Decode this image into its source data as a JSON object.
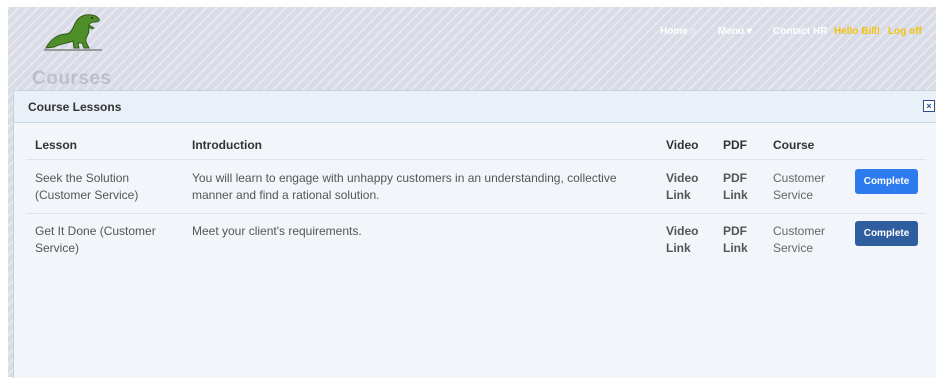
{
  "page": {
    "heading": "Courses"
  },
  "nav": {
    "home": "Home",
    "menu": "Menu",
    "contact": "Contact HR",
    "greeting": "Hello Bill!",
    "logoff": "Log off"
  },
  "icons": {
    "home": "home-icon",
    "menu": "caret-down-icon",
    "close": "close-icon",
    "logo": "dinosaur-logo"
  },
  "colors": {
    "primary_button": "#2e7bf0",
    "secondary_button": "#2f5e9e",
    "nav_highlight": "#f2c20f"
  },
  "dialog": {
    "title": "Course Lessons",
    "close_label": "×",
    "columns": [
      "Lesson",
      "Introduction",
      "Video",
      "PDF",
      "Course"
    ],
    "rows": [
      {
        "lesson_l1": "Seek the Solution",
        "lesson_l2": "(Customer Service)",
        "intro_l1": "You will learn to engage with unhappy customers in an understanding, collective",
        "intro_l2": "manner and find a rational solution.",
        "video_l1": "Video",
        "video_l2": "Link",
        "pdf_l1": "PDF",
        "pdf_l2": "Link",
        "course_l1": "Customer",
        "course_l2": "Service",
        "action": "Complete"
      },
      {
        "lesson_l1": "Get It Done (Customer",
        "lesson_l2": "Service)",
        "intro_l1": "Meet your client's requirements.",
        "intro_l2": "",
        "video_l1": "Video",
        "video_l2": "Link",
        "pdf_l1": "PDF",
        "pdf_l2": "Link",
        "course_l1": "Customer",
        "course_l2": "Service",
        "action": "Complete"
      }
    ]
  }
}
